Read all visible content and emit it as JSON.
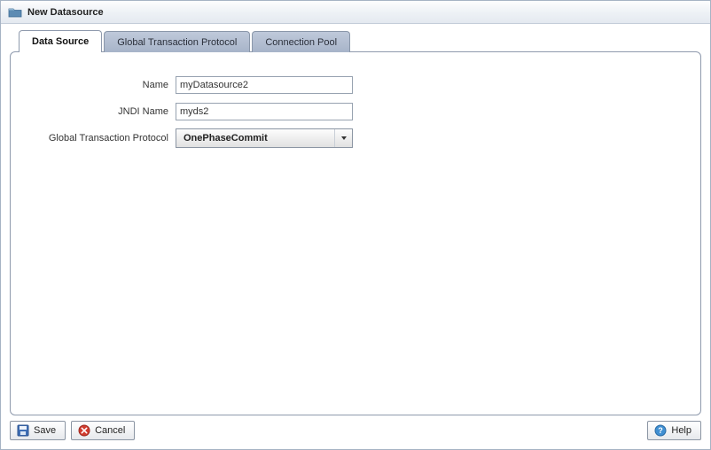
{
  "window": {
    "title": "New Datasource"
  },
  "tabs": [
    {
      "label": "Data Source",
      "active": true
    },
    {
      "label": "Global Transaction Protocol",
      "active": false
    },
    {
      "label": "Connection Pool",
      "active": false
    }
  ],
  "form": {
    "name": {
      "label": "Name",
      "value": "myDatasource2"
    },
    "jndi": {
      "label": "JNDI Name",
      "value": "myds2"
    },
    "gtp": {
      "label": "Global Transaction Protocol",
      "value": "OnePhaseCommit"
    }
  },
  "footer": {
    "save": "Save",
    "cancel": "Cancel",
    "help": "Help"
  }
}
